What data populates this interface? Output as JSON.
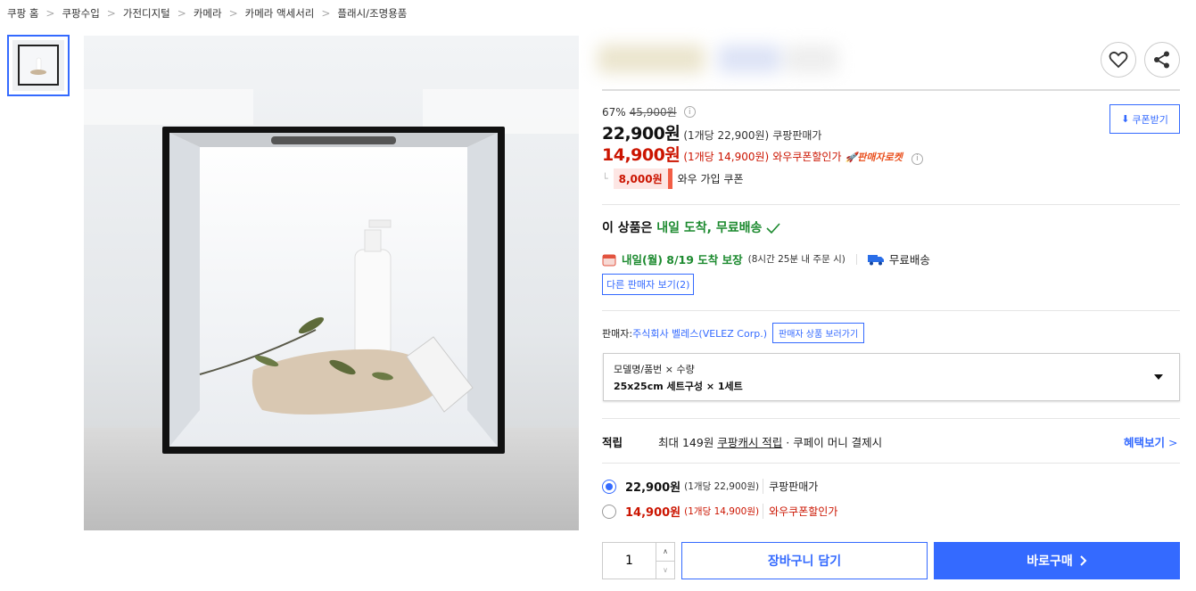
{
  "breadcrumb": [
    "쿠팡 홈",
    "쿠팡수입",
    "가전디지털",
    "카메라",
    "카메라 액세서리",
    "플래시/조명용품"
  ],
  "price": {
    "discount_rate": "67%",
    "original": "45,900원",
    "sale": "22,900원",
    "sale_unit": "(1개당 22,900원)",
    "sale_label": "쿠팡판매가",
    "coupon_price": "14,900원",
    "coupon_unit": "(1개당 14,900원)",
    "coupon_label": "와우쿠폰할인가",
    "rocket_label": "판매자로켓",
    "wow_badge": "8,000원",
    "wow_label": "와우 가입 쿠폰"
  },
  "coupon_button": "쿠폰받기",
  "delivery": {
    "headline_prefix": "이 상품은 ",
    "headline_highlight": "내일 도착, 무료배송",
    "date": "내일(월) 8/19 도착 보장",
    "cutoff": "(8시간 25분 내 주문 시)",
    "free": "무료배송",
    "other_sellers": "다른 판매자 보기(2)"
  },
  "seller": {
    "label": "판매자: ",
    "name": "주식회사 벨레스(VELEZ Corp.)",
    "link": "판매자 상품 보러가기"
  },
  "option": {
    "label": "모델명/품번 × 수량",
    "value": "25x25cm 세트구성 × 1세트"
  },
  "points": {
    "label": "적립",
    "text_prefix": "최대 149원 ",
    "text_link": "쿠팡캐시 적립",
    "text_suffix": " · 쿠페이 머니 결제시",
    "benefit": "혜택보기"
  },
  "price_options": [
    {
      "price": "22,900원",
      "unit": "(1개당 22,900원)",
      "label": "쿠팡판매가",
      "selected": true
    },
    {
      "price": "14,900원",
      "unit": "(1개당 14,900원)",
      "label": "와우쿠폰할인가",
      "selected": false
    }
  ],
  "quantity": "1",
  "cart_button": "장바구니 담기",
  "buy_button": "바로구매",
  "colors": {
    "accent": "#346aff",
    "red": "#cb1400",
    "green": "#1c8a2f",
    "rocket": "#e94e1b"
  }
}
